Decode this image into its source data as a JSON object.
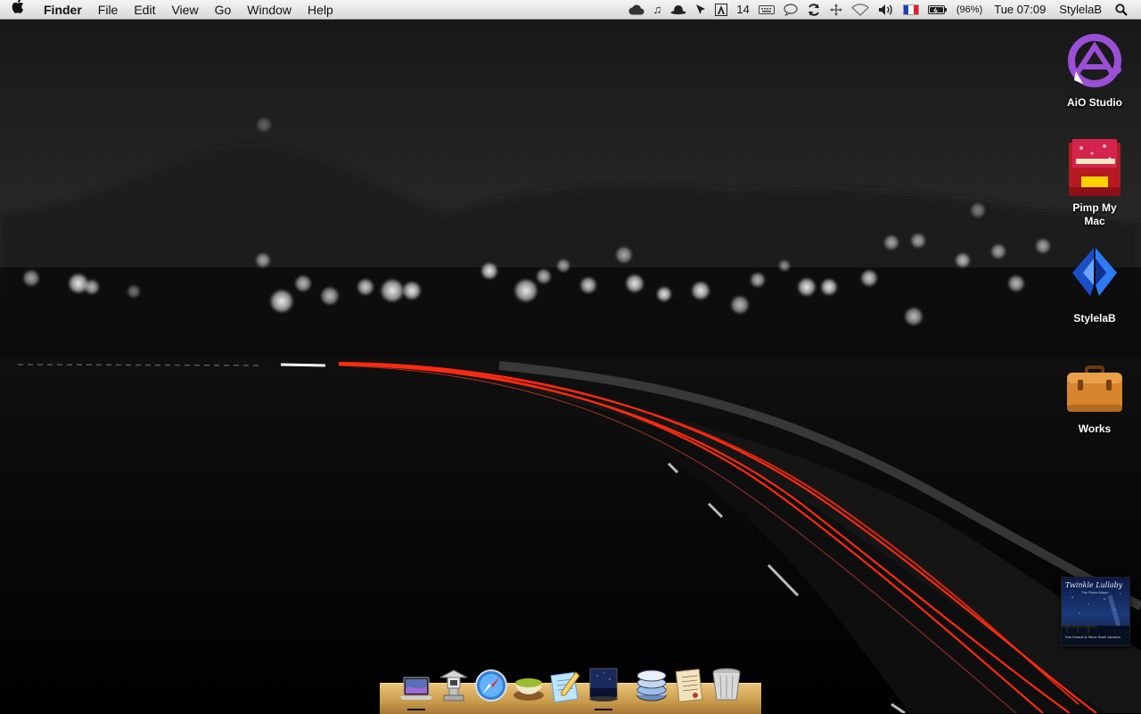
{
  "menubar": {
    "apple_icon": "apple-icon",
    "app_name": "Finder",
    "menus": [
      "File",
      "Edit",
      "View",
      "Go",
      "Window",
      "Help"
    ],
    "status": {
      "adobe_count": "14",
      "battery_percent": "(96%)",
      "clock": "Tue 07:09",
      "user": "StylelaB"
    }
  },
  "desktop": {
    "icons": [
      {
        "label": "AiO Studio",
        "icon": "aio-studio-icon"
      },
      {
        "label": "Pimp My Mac",
        "icon": "pimp-my-mac-icon"
      },
      {
        "label": "StylelaB",
        "icon": "stylelab-icon"
      },
      {
        "label": "Works",
        "icon": "briefcase-icon"
      }
    ]
  },
  "album": {
    "title": "Twinkle Lullaby",
    "subtitle": "The Piano Album",
    "artist": "Sue Dristoll & Steve Stark Jamison"
  },
  "dock": {
    "apps": [
      "macbook-icon",
      "lantern-icon",
      "safari-icon",
      "tea-icon",
      "textedit-icon",
      "itunes-icon",
      "stack-icon",
      "letter-icon",
      "trash-icon"
    ]
  },
  "colors": {
    "accent_purple": "#8b3fc6",
    "tail_light_red": "#ff2a10",
    "dock_wood": "#d4a65a"
  }
}
